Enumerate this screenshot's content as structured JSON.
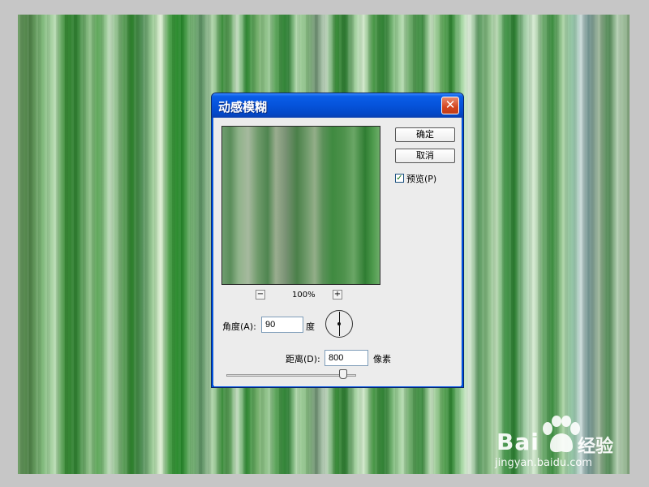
{
  "dialog": {
    "title": "动感模糊",
    "close_symbol": "✕",
    "ok_label": "确定",
    "cancel_label": "取消",
    "preview_label": "预览(P)",
    "preview_checked": true,
    "zoom_out": "−",
    "zoom_in": "+",
    "zoom_level": "100%",
    "angle_label": "角度(A):",
    "angle_value": "90",
    "angle_unit": "度",
    "distance_label": "距离(D):",
    "distance_value": "800",
    "distance_unit": "像素"
  },
  "watermark": {
    "brand_text": "Bai",
    "brand_suffix": "经验",
    "url": "jingyan.baidu.com",
    "icon": "paw-icon"
  }
}
